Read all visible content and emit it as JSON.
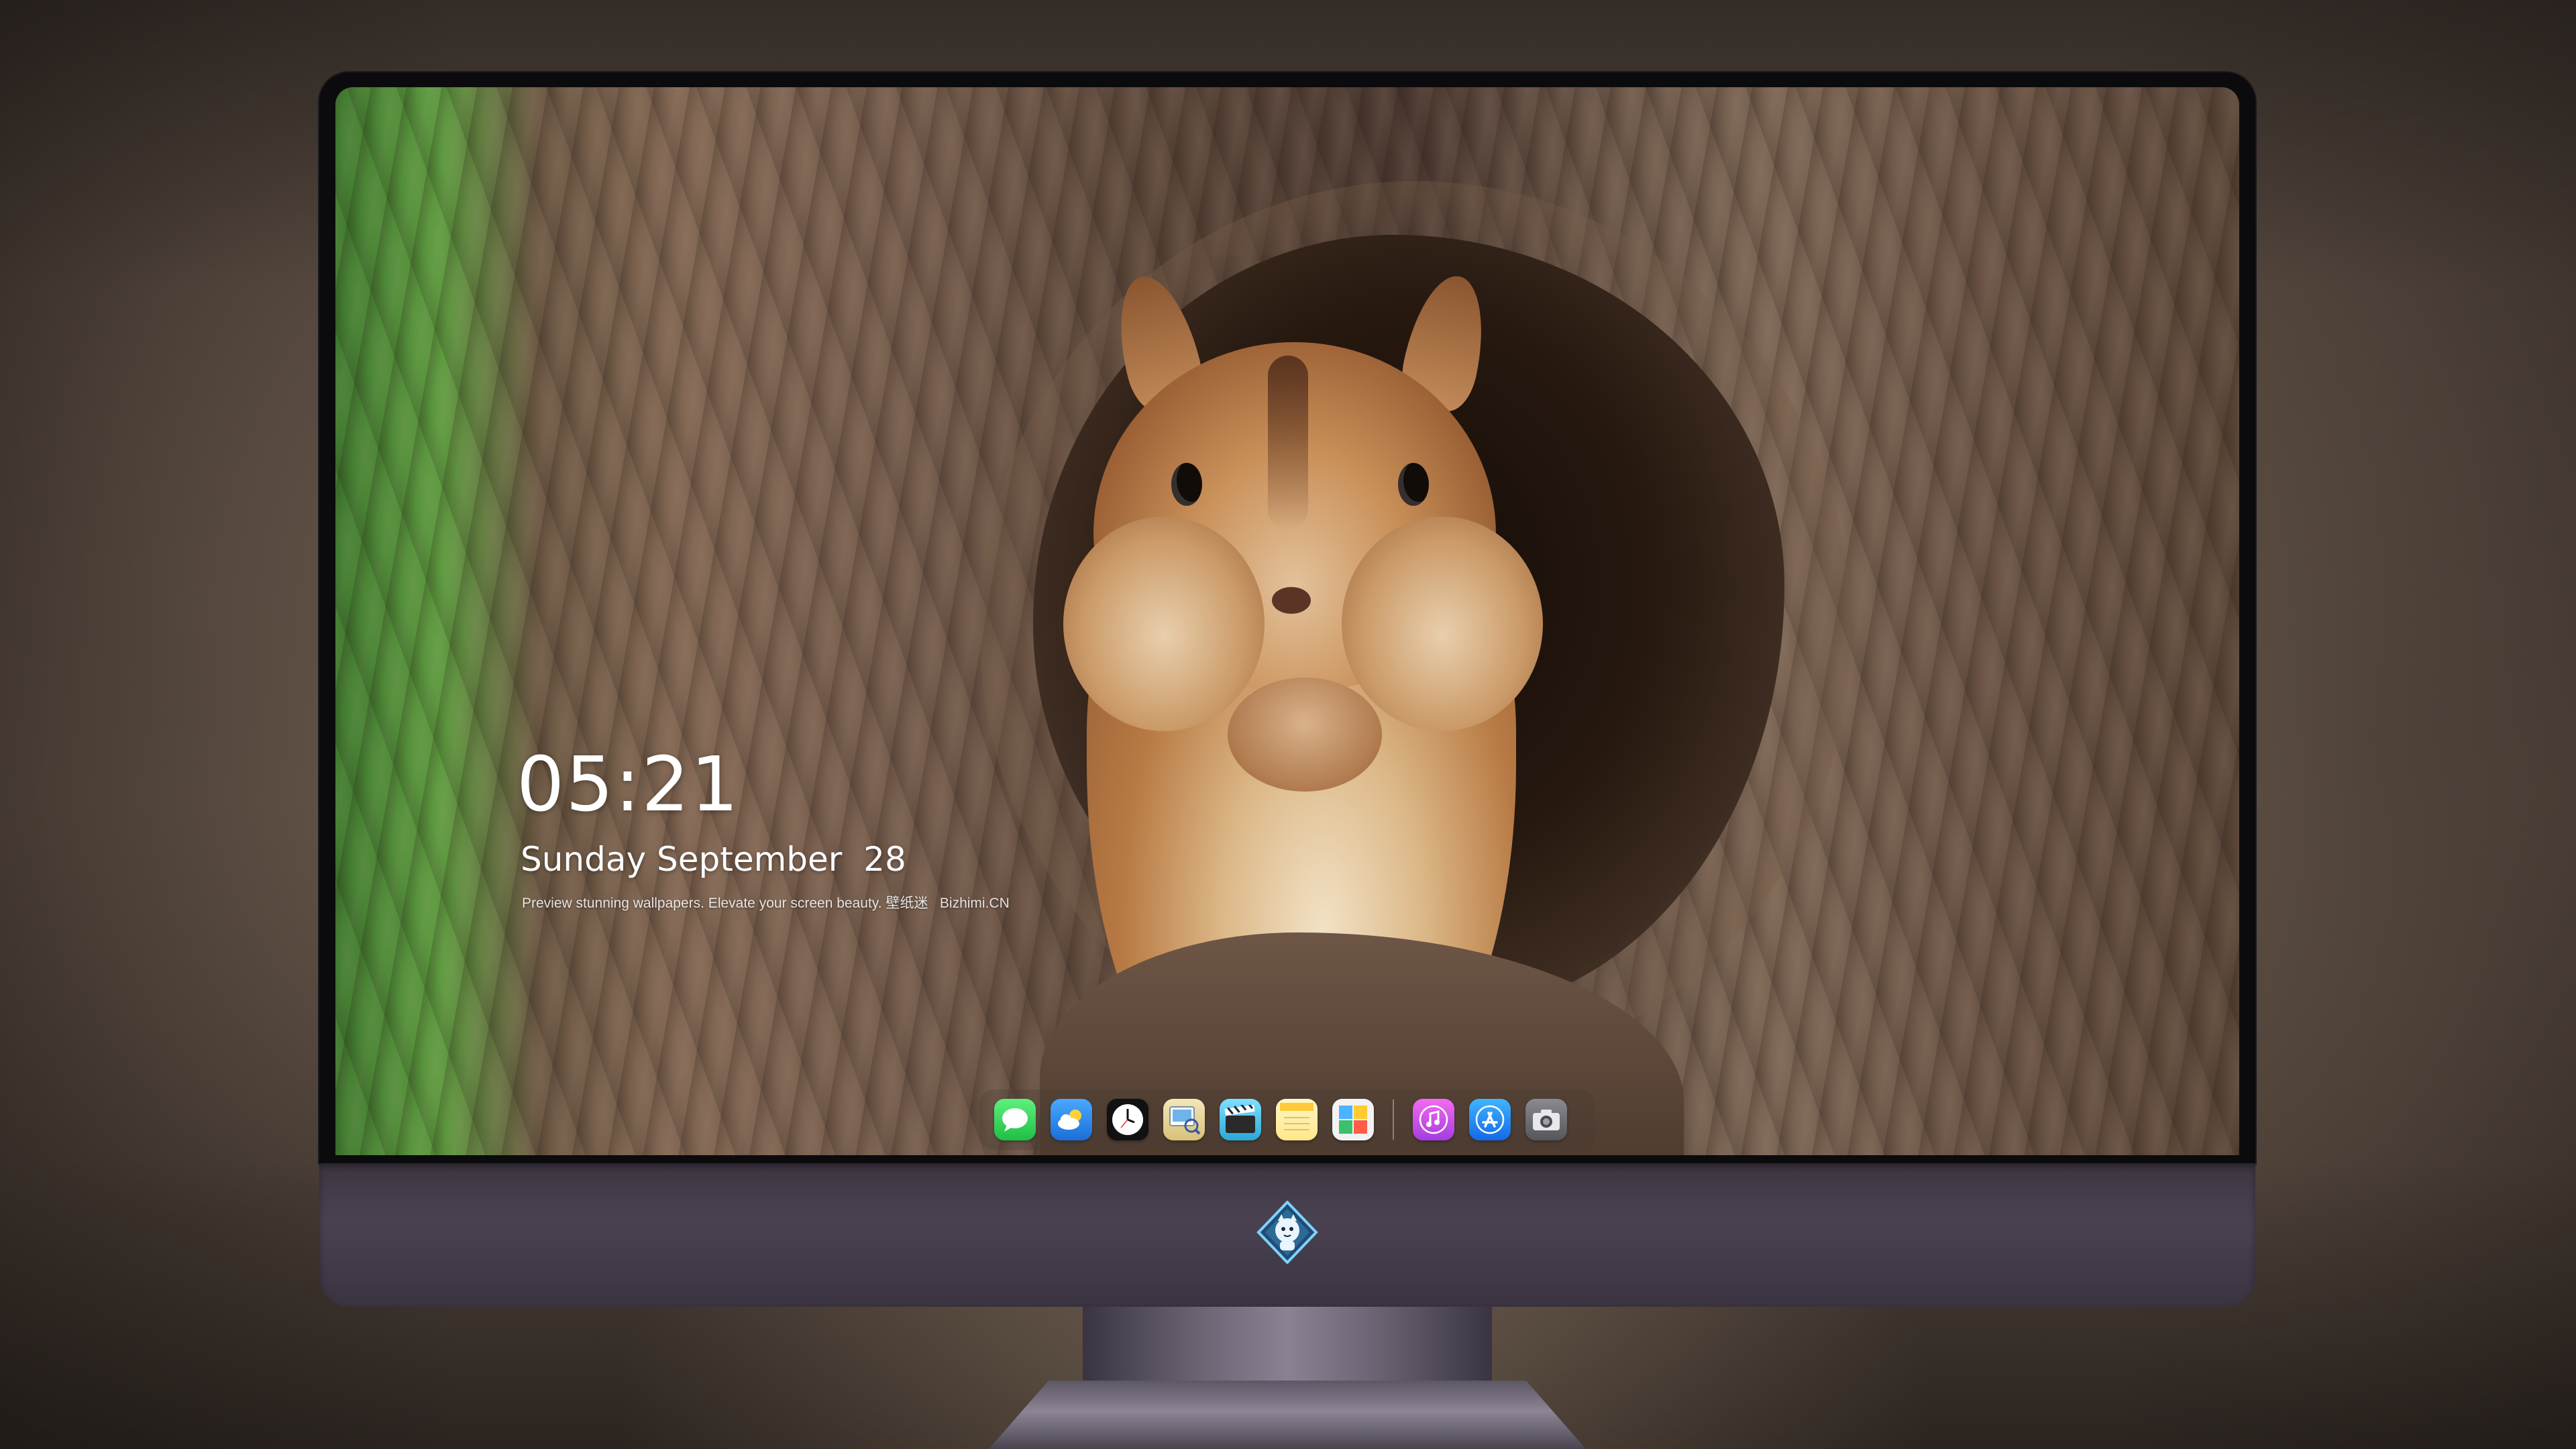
{
  "lock_screen": {
    "time": "05:21",
    "date": "Sunday September  28",
    "caption": "Preview stunning wallpapers. Elevate your screen beauty. 壁纸迷   Bizhimi.CN"
  },
  "dock": {
    "apps": [
      {
        "name": "Messages",
        "icon": "messages-icon",
        "color": "#2fd159"
      },
      {
        "name": "Weather",
        "icon": "weather-icon",
        "color": "#2b8ff0"
      },
      {
        "name": "Clock",
        "icon": "clock-icon",
        "color": "#111111"
      },
      {
        "name": "Preview",
        "icon": "preview-icon",
        "color": "#e9d9a2"
      },
      {
        "name": "Clips",
        "icon": "clapperboard-icon",
        "color": "#3fc3e8"
      },
      {
        "name": "Notes",
        "icon": "notes-icon",
        "color": "#ffd84a"
      },
      {
        "name": "Photo Booth",
        "icon": "photo-booth-icon",
        "color": "#e8e8e8"
      },
      {
        "name": "iTunes",
        "icon": "music-icon",
        "color": "#d24de0"
      },
      {
        "name": "App Store",
        "icon": "app-store-icon",
        "color": "#1c8ef0"
      },
      {
        "name": "Screenshot",
        "icon": "camera-icon",
        "color": "#6d6d72"
      }
    ]
  },
  "colors": {
    "chin": "#3d3642",
    "bezel": "#0b0b0d",
    "text": "#ffffff"
  }
}
